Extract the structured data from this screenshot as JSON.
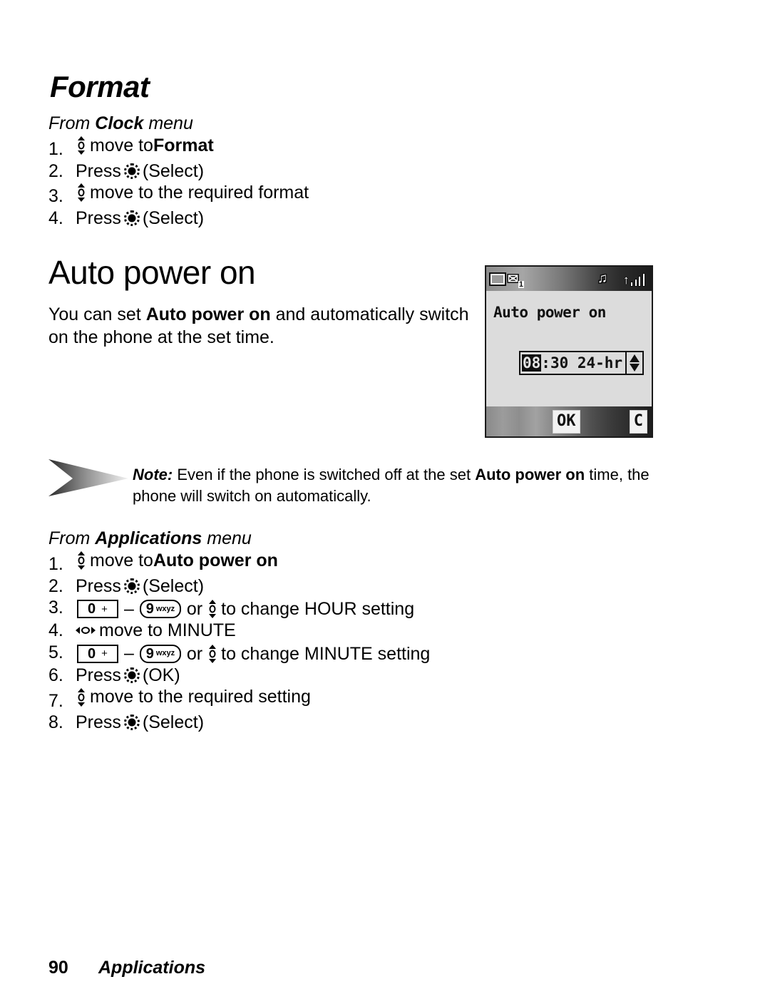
{
  "document": {
    "section_format": {
      "heading": "Format",
      "from_line_prefix": "From ",
      "from_line_menu": "Clock",
      "from_line_suffix": " menu",
      "steps": [
        {
          "num": "1.",
          "icon": "updown-nav-icon",
          "pre": "",
          "text_before": "move to ",
          "bold": "Format",
          "text_after": ""
        },
        {
          "num": "2.",
          "icon": "select-key-icon",
          "pre": "Press ",
          "text_before": "",
          "bold": "",
          "text_after": "(Select)"
        },
        {
          "num": "3.",
          "icon": "updown-nav-icon",
          "pre": "",
          "text_before": "move to the required format",
          "bold": "",
          "text_after": ""
        },
        {
          "num": "4.",
          "icon": "select-key-icon",
          "pre": "Press ",
          "text_before": "",
          "bold": "",
          "text_after": "(Select)"
        }
      ]
    },
    "section_auto_power_on": {
      "heading": "Auto power on",
      "intro_part1": "You can set ",
      "intro_bold": "Auto power on",
      "intro_part2": " and automatically switch on the phone at the set time.",
      "note": {
        "label": "Note:",
        "part1": " Even if the phone is switched off at the set ",
        "bold": "Auto power on",
        "part2": " time, the phone will switch on automatically."
      },
      "from_line_prefix": "From ",
      "from_line_menu": "Applications",
      "from_line_suffix": " menu",
      "steps": [
        {
          "num": "1.",
          "icon": "updown-nav-icon",
          "pre": "",
          "text_before": "move to ",
          "bold": "Auto power on",
          "text_after": ""
        },
        {
          "num": "2.",
          "icon": "select-key-icon",
          "pre": "Press ",
          "text_before": "",
          "bold": "",
          "text_after": "(Select)"
        },
        {
          "num": "3.",
          "icon": "keyrange",
          "pre": "",
          "text_before": "",
          "bold": "",
          "text_after": "or",
          "tail": "to change HOUR setting"
        },
        {
          "num": "4.",
          "icon": "leftright-nav-icon",
          "pre": "",
          "text_before": "move to MINUTE",
          "bold": "",
          "text_after": ""
        },
        {
          "num": "5.",
          "icon": "keyrange",
          "pre": "",
          "text_before": "",
          "bold": "",
          "text_after": "or",
          "tail": "to change MINUTE setting"
        },
        {
          "num": "6.",
          "icon": "select-key-icon",
          "pre": "Press ",
          "text_before": "",
          "bold": "",
          "text_after": "(OK)"
        },
        {
          "num": "7.",
          "icon": "updown-nav-icon",
          "pre": "",
          "text_before": "move to the required setting",
          "bold": "",
          "text_after": ""
        },
        {
          "num": "8.",
          "icon": "select-key-icon",
          "pre": "Press ",
          "text_before": "",
          "bold": "",
          "text_after": "(Select)"
        }
      ]
    },
    "keys": {
      "key0_digit": "0",
      "key0_label": "+",
      "key9_digit": "9",
      "key9_label": "wxyz",
      "range_dash": "–",
      "or_word": "or"
    },
    "phone_screen": {
      "status_icons": [
        "battery-icon",
        "message-icon",
        "melody-icon",
        "signal-icon"
      ],
      "message_count": "1",
      "title": "Auto power on",
      "time_selected": "08",
      "time_rest": ":30 24-hr",
      "spinner": "up-down-spinner-icon",
      "softkey_left": "OK",
      "softkey_right": "C"
    },
    "footer": {
      "page_number": "90",
      "chapter": "Applications"
    }
  }
}
